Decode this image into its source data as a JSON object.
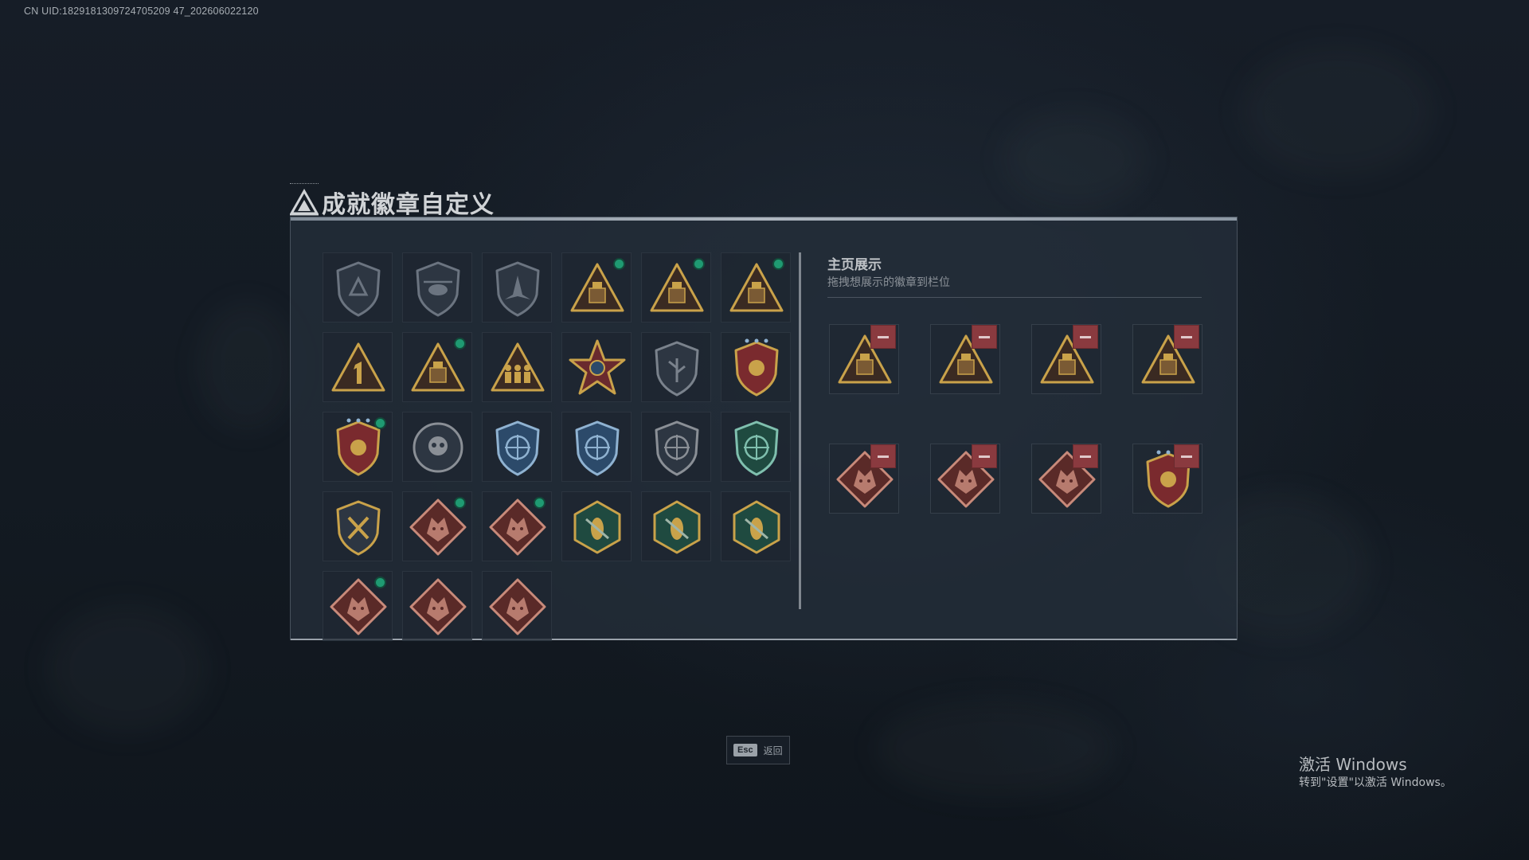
{
  "watermark": {
    "uid_text": "CN UID:1829181309724705209 47_202606022120"
  },
  "page": {
    "title": "成就徽章自定义",
    "title_icon": "triangle-emblem-icon"
  },
  "badge_inventory": [
    {
      "icon": "shield-triangle-badge",
      "new": false,
      "colors": [
        "#2d3642",
        "#6b7480"
      ]
    },
    {
      "icon": "shield-helicopter-badge",
      "new": false,
      "colors": [
        "#2d3642",
        "#6b7480"
      ]
    },
    {
      "icon": "shield-jet-badge",
      "new": false,
      "colors": [
        "#2d3642",
        "#6b7480"
      ]
    },
    {
      "icon": "triangle-crate-gold-badge",
      "new": true,
      "colors": [
        "#3a2a22",
        "#c9a24a"
      ]
    },
    {
      "icon": "triangle-crate-gold-badge",
      "new": true,
      "colors": [
        "#3a2a22",
        "#c9a24a"
      ]
    },
    {
      "icon": "triangle-crate-gold-badge",
      "new": true,
      "colors": [
        "#3a2a22",
        "#c9a24a"
      ]
    },
    {
      "icon": "triangle-number-one-badge",
      "new": false,
      "colors": [
        "#3a2a22",
        "#c9a24a"
      ]
    },
    {
      "icon": "triangle-crate-gold-badge",
      "new": true,
      "colors": [
        "#3a2a22",
        "#c9a24a"
      ]
    },
    {
      "icon": "triangle-soldiers-badge",
      "new": false,
      "colors": [
        "#3a2a22",
        "#c9a24a"
      ]
    },
    {
      "icon": "star-medal-badge",
      "new": false,
      "colors": [
        "#6a2a2e",
        "#c9a24a"
      ]
    },
    {
      "icon": "shield-plant-badge",
      "new": false,
      "colors": [
        "#2d3642",
        "#7a828c"
      ]
    },
    {
      "icon": "crest-stars-badge",
      "new": false,
      "colors": [
        "#7a2a2e",
        "#c9a24a"
      ]
    },
    {
      "icon": "crest-stars-badge",
      "new": true,
      "colors": [
        "#7a2a2e",
        "#c9a24a"
      ]
    },
    {
      "icon": "round-skull-badge",
      "new": false,
      "colors": [
        "#2d3642",
        "#8a8f96"
      ]
    },
    {
      "icon": "shield-crosshair-badge",
      "new": false,
      "colors": [
        "#2c4a6a",
        "#8fb2d1"
      ]
    },
    {
      "icon": "shield-crosshair-badge",
      "new": false,
      "colors": [
        "#2c4a6a",
        "#8fb2d1"
      ]
    },
    {
      "icon": "shield-crosshair-badge",
      "new": false,
      "colors": [
        "#2d3642",
        "#8a8f96"
      ]
    },
    {
      "icon": "shield-crosshair-badge",
      "new": false,
      "colors": [
        "#1f4a40",
        "#7fbfae"
      ]
    },
    {
      "icon": "shield-swords-badge",
      "new": false,
      "colors": [
        "#2d3642",
        "#c9a24a"
      ]
    },
    {
      "icon": "diamond-beast-badge",
      "new": true,
      "colors": [
        "#5a2a28",
        "#c88a7a"
      ]
    },
    {
      "icon": "diamond-beast-badge",
      "new": true,
      "colors": [
        "#5a2a28",
        "#c88a7a"
      ]
    },
    {
      "icon": "hex-wasp-badge",
      "new": false,
      "colors": [
        "#1f4a40",
        "#c9a24a"
      ]
    },
    {
      "icon": "hex-wasp-badge",
      "new": false,
      "colors": [
        "#1f4a40",
        "#c9a24a"
      ]
    },
    {
      "icon": "hex-hammer-badge",
      "new": false,
      "colors": [
        "#1f4a40",
        "#c9a24a"
      ]
    },
    {
      "icon": "diamond-dragon-badge",
      "new": true,
      "colors": [
        "#5a2a28",
        "#c88a7a"
      ]
    },
    {
      "icon": "diamond-dragon-badge",
      "new": false,
      "colors": [
        "#5a2a28",
        "#c88a7a"
      ]
    },
    {
      "icon": "diamond-runner-badge",
      "new": false,
      "colors": [
        "#5a2a28",
        "#c88a7a"
      ]
    }
  ],
  "display": {
    "heading": "主页展示",
    "subheading": "拖拽想展示的徽章到栏位",
    "remove_icon": "minus-icon",
    "slots": [
      {
        "icon": "triangle-crate-gold-badge",
        "colors": [
          "#3a2a22",
          "#c9a24a"
        ]
      },
      {
        "icon": "triangle-crate-gold-badge",
        "colors": [
          "#3a2a22",
          "#c9a24a"
        ]
      },
      {
        "icon": "triangle-crate-gold-badge",
        "colors": [
          "#3a2a22",
          "#c9a24a"
        ]
      },
      {
        "icon": "triangle-crate-gold-badge",
        "colors": [
          "#3a2a22",
          "#c9a24a"
        ]
      },
      {
        "icon": "diamond-dragon-badge",
        "colors": [
          "#5a2a28",
          "#c88a7a"
        ]
      },
      {
        "icon": "diamond-beast-badge",
        "colors": [
          "#5a2a28",
          "#c88a7a"
        ]
      },
      {
        "icon": "diamond-beast-badge",
        "colors": [
          "#5a2a28",
          "#c88a7a"
        ]
      },
      {
        "icon": "crest-stars-badge",
        "colors": [
          "#7a2a2e",
          "#c9a24a"
        ]
      }
    ]
  },
  "footer": {
    "esc_key": "Esc",
    "esc_label": "返回"
  },
  "windows_watermark": {
    "title": "激活 Windows",
    "subtitle": "转到\"设置\"以激活 Windows。"
  }
}
